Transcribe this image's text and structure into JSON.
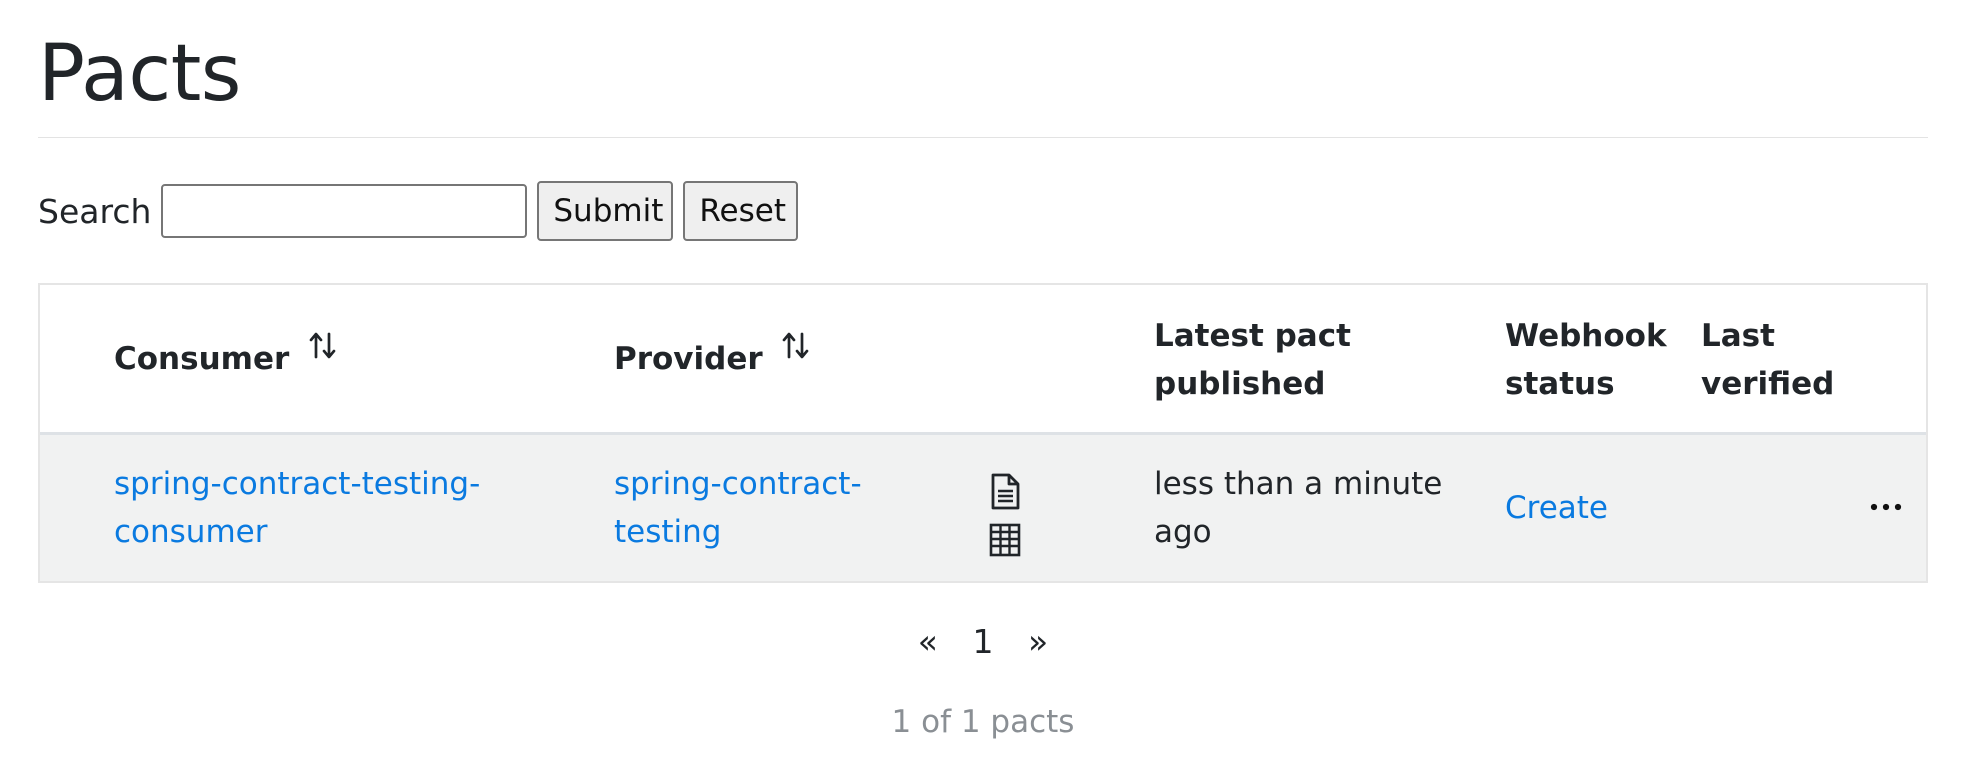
{
  "page": {
    "title": "Pacts"
  },
  "search": {
    "label": "Search",
    "value": "",
    "placeholder": "",
    "submit_label": "Submit",
    "reset_label": "Reset"
  },
  "table": {
    "columns": {
      "consumer": "Consumer",
      "provider": "Provider",
      "latest_pact_published": "Latest pact published",
      "webhook_status": "Webhook status",
      "last_verified": "Last verified"
    },
    "rows": [
      {
        "consumer": "spring-contract-testing-consumer",
        "provider": "spring-contract-testing",
        "latest_pact_published": "less than a minute ago",
        "webhook_status": "Create",
        "last_verified": "",
        "icons": [
          "document-icon",
          "table-grid-icon",
          "more-options-icon"
        ]
      }
    ]
  },
  "pagination": {
    "prev": "«",
    "current": "1",
    "next": "»"
  },
  "summary": "1 of 1 pacts",
  "colors": {
    "link": "#0a7ae0",
    "row_background": "#f1f2f2",
    "muted_text": "#8a8f94"
  }
}
